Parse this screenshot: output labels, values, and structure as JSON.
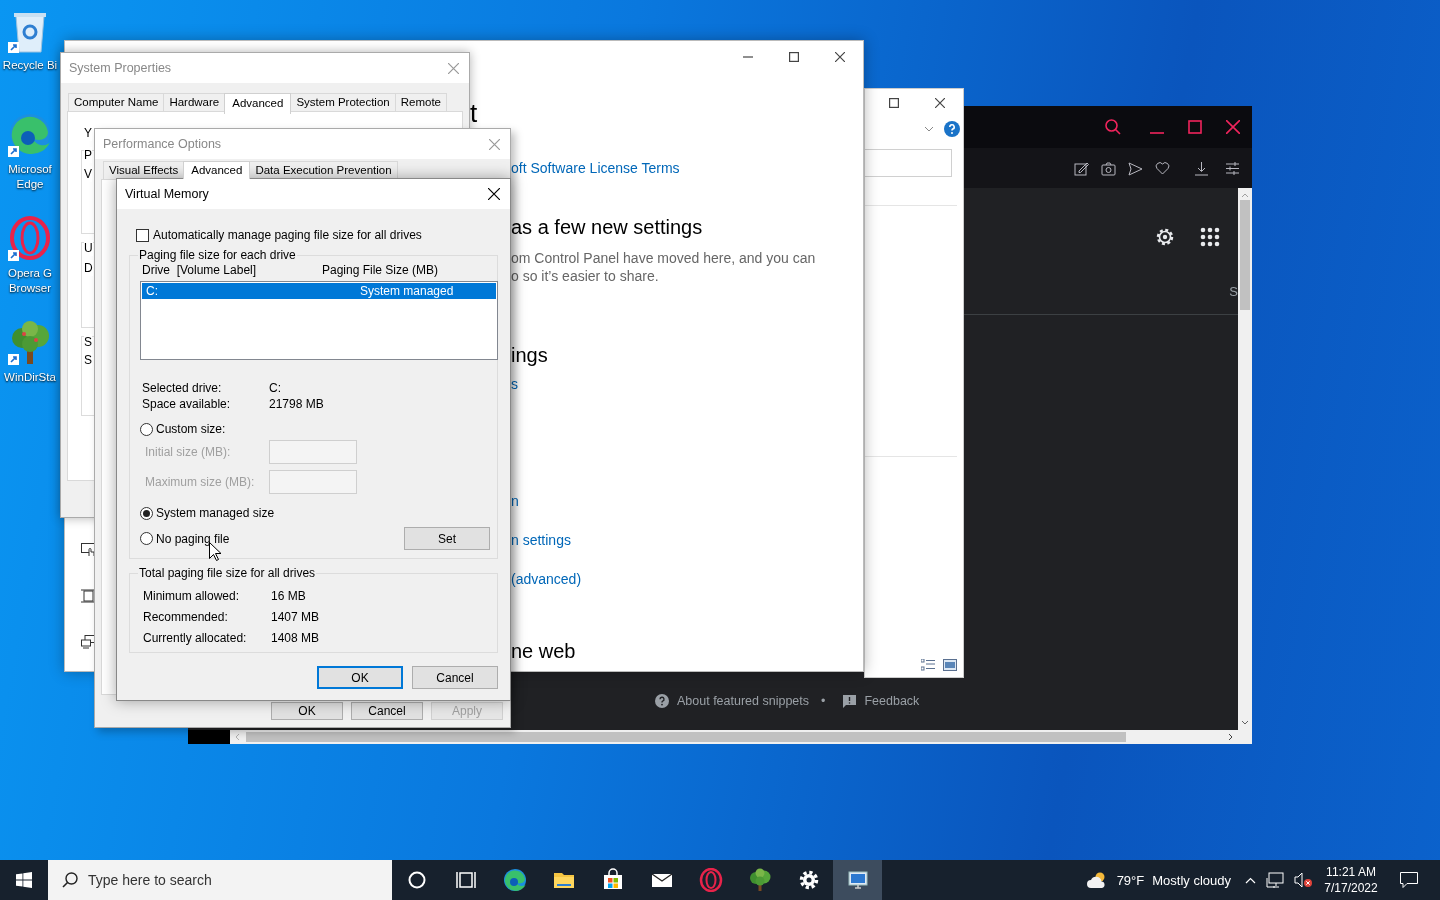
{
  "desktop_icons": [
    {
      "kind": "recycle",
      "label": "Recycle Bi"
    },
    {
      "kind": "swirl",
      "label": "Microsof\nEdge"
    },
    {
      "kind": "ring",
      "label": "Opera G\nBrowser"
    },
    {
      "kind": "tree",
      "label": "WinDirSta"
    }
  ],
  "browser": {
    "side_letter": "S",
    "footer": [
      {
        "kind": "help",
        "text": "About featured snippets"
      },
      {
        "kind": "dot",
        "text": "•"
      },
      {
        "kind": "feedback",
        "text": "Feedback"
      }
    ]
  },
  "settings_window": {
    "fragments": [
      {
        "kind": "heading-large",
        "text": "t"
      },
      {
        "kind": "link",
        "text": "oft Software License Terms"
      },
      {
        "kind": "heading",
        "text": "as a few new settings"
      },
      {
        "kind": "body",
        "text": "om Control Panel have moved here, and you can"
      },
      {
        "kind": "body",
        "text": "o so it’s easier to share."
      },
      {
        "kind": "heading",
        "text": "ings"
      },
      {
        "kind": "link",
        "text": "s"
      },
      {
        "kind": "link",
        "text": "n"
      },
      {
        "kind": "link",
        "text": "n settings"
      },
      {
        "kind": "link",
        "text": "(advanced)"
      },
      {
        "kind": "heading",
        "text": "ne web"
      }
    ]
  },
  "system_properties": {
    "title": "System Properties",
    "tabs": [
      {
        "label": "Computer Name",
        "selected": false
      },
      {
        "label": "Hardware",
        "selected": false
      },
      {
        "label": "Advanced",
        "selected": true
      },
      {
        "label": "System Protection",
        "selected": false
      },
      {
        "label": "Remote",
        "selected": false
      }
    ],
    "fragments": [
      "Y",
      "P",
      "V",
      "U",
      "D",
      "S",
      "S"
    ]
  },
  "performance_options": {
    "title": "Performance Options",
    "tabs": [
      {
        "label": "Visual Effects",
        "selected": false
      },
      {
        "label": "Advanced",
        "selected": true
      },
      {
        "label": "Data Execution Prevention",
        "selected": false
      }
    ],
    "buttons": [
      {
        "label": "OK",
        "disabled": false
      },
      {
        "label": "Cancel",
        "disabled": false
      },
      {
        "label": "Apply",
        "disabled": true
      }
    ]
  },
  "virtual_memory": {
    "title": "Virtual Memory",
    "auto_manage": {
      "label": "Automatically manage paging file size for all drives",
      "checked": false
    },
    "drive_group": "Paging file size for each drive",
    "columns": [
      "Drive  [Volume Label]",
      "Paging File Size (MB)"
    ],
    "drives": [
      {
        "drive": "C:",
        "size": "System managed",
        "selected": true
      }
    ],
    "drive_info": [
      {
        "label": "Selected drive:",
        "value": "C:"
      },
      {
        "label": "Space available:",
        "value": "21798 MB"
      }
    ],
    "options": [
      {
        "label": "Custom size:",
        "selected": false
      },
      {
        "label": "System managed size",
        "selected": true
      },
      {
        "label": "No paging file",
        "selected": false
      }
    ],
    "size_fields": [
      {
        "label": "Initial size (MB):",
        "disabled": true
      },
      {
        "label": "Maximum size (MB):",
        "disabled": true
      }
    ],
    "set_button": "Set",
    "totals_group": "Total paging file size for all drives",
    "totals": [
      {
        "label": "Minimum allowed:",
        "value": "16 MB"
      },
      {
        "label": "Recommended:",
        "value": "1407 MB"
      },
      {
        "label": "Currently allocated:",
        "value": "1408 MB"
      }
    ],
    "buttons": [
      {
        "label": "OK",
        "default": true
      },
      {
        "label": "Cancel",
        "default": false
      }
    ]
  },
  "taskbar": {
    "search_placeholder": "Type here to search",
    "apps": [
      {
        "kind": "circle",
        "active": false
      },
      {
        "kind": "taskview",
        "active": false
      },
      {
        "kind": "swirl",
        "active": false
      },
      {
        "kind": "folder",
        "active": false
      },
      {
        "kind": "bag",
        "active": false
      },
      {
        "kind": "mail",
        "active": false
      },
      {
        "kind": "ring",
        "active": false
      },
      {
        "kind": "tree",
        "active": false
      },
      {
        "kind": "gear",
        "active": false
      },
      {
        "kind": "monitor",
        "active": true
      }
    ],
    "weather": {
      "temperature": "79°F",
      "condition": "Mostly cloudy"
    },
    "clock": {
      "time": "11:21 AM",
      "date": "7/17/2022"
    }
  }
}
